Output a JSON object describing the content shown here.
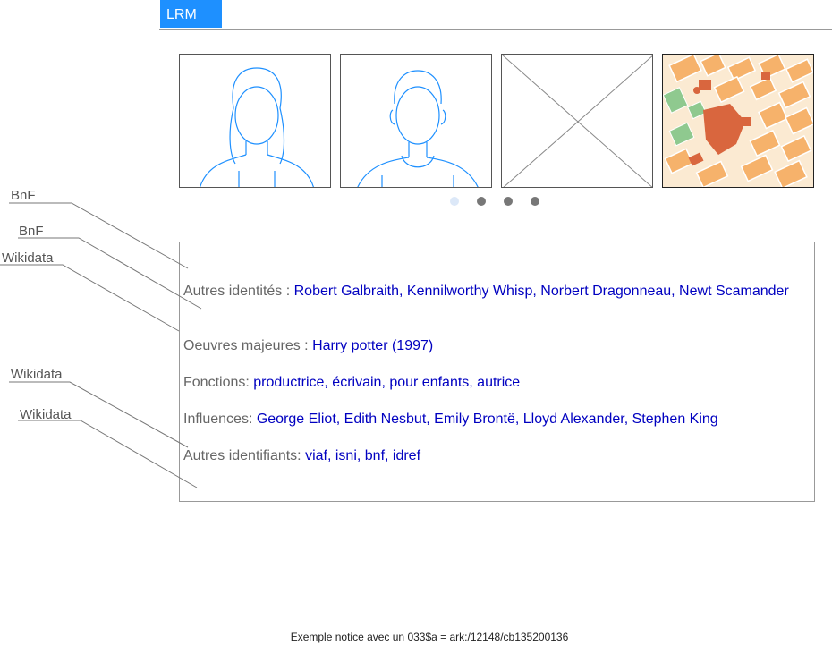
{
  "tabs": {
    "lrm": "LRM"
  },
  "carousel": {
    "images": [
      "female-portrait-icon",
      "male-portrait-icon",
      "image-placeholder-icon",
      "map-thumbnail"
    ],
    "page_count": 4,
    "active_index": 0
  },
  "side_labels": [
    "BnF",
    "BnF",
    "Wikidata",
    "Wikidata",
    "Wikidata"
  ],
  "fields": {
    "autres_identites": {
      "label": "Autres identités : ",
      "value": "Robert Galbraith, Kennilworthy Whisp, Norbert Dragonneau, Newt Scamander"
    },
    "oeuvres": {
      "label": "Oeuvres majeures : ",
      "value": "Harry potter (1997)"
    },
    "fonctions": {
      "label": "Fonctions: ",
      "value": "productrice, écrivain, pour enfants, autrice"
    },
    "influences": {
      "label": "Influences: ",
      "value": "George Eliot, Edith Nesbut, Emily Brontë, Lloyd Alexander, Stephen King"
    },
    "identifiants": {
      "label": "Autres identifiants: ",
      "value": "viaf, isni, bnf, idref"
    }
  },
  "footer": "Exemple notice avec un 033$a = ark:/12148/cb135200136",
  "colors": {
    "accent": "#1e90ff",
    "link": "#0000c0",
    "portrait_stroke": "#1e90ff"
  }
}
